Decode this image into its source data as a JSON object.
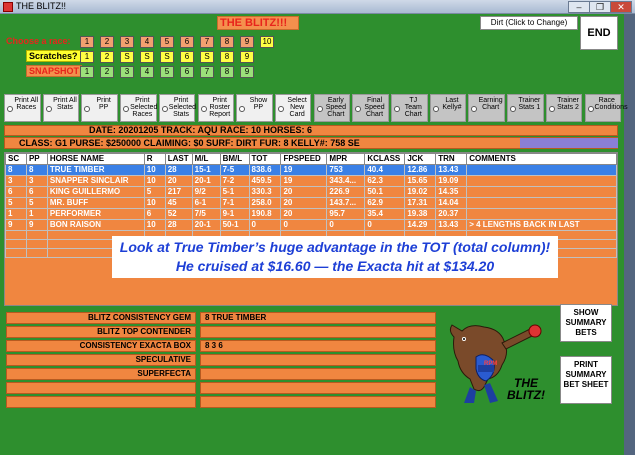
{
  "window": {
    "title": "THE BLITZ!!",
    "buttons": [
      "–",
      "❐",
      "✕"
    ]
  },
  "header": {
    "app_title": "THE BLITZ!!!",
    "surface_button": "Dirt (Click to Change)",
    "end_button": "END"
  },
  "race_select": {
    "choose_label": "Choose a race:",
    "scratches_label": "Scratches?",
    "snapshot_label": "SNAPSHOT",
    "race_numbers": [
      "1",
      "2",
      "3",
      "4",
      "5",
      "6",
      "7",
      "8",
      "9",
      "10"
    ],
    "scratch_marks": [
      "1",
      "2",
      "S",
      "S",
      "S",
      "6",
      "S",
      "8",
      "9"
    ],
    "snapshot_numbers": [
      "1",
      "2",
      "3",
      "4",
      "5",
      "6",
      "7",
      "8",
      "9"
    ]
  },
  "options": [
    {
      "label": "Print All Races"
    },
    {
      "label": "Print All Stats"
    },
    {
      "label": "Print PP"
    },
    {
      "label": "Print Selected Races"
    },
    {
      "label": "Print Selected Stats"
    },
    {
      "label": "Print Roster Report"
    },
    {
      "label": "Show PP"
    },
    {
      "label": "Select New Card"
    },
    {
      "label": "Early Speed Chart"
    },
    {
      "label": "Final Speed Chart"
    },
    {
      "label": "TJ Team Chart"
    },
    {
      "label": "Last Kelly#"
    },
    {
      "label": "Earning Chart"
    },
    {
      "label": "Trainer Stats 1"
    },
    {
      "label": "Trainer Stats 2"
    },
    {
      "label": "Race Conditions"
    }
  ],
  "race_info": {
    "line1": "DATE: 20201205     TRACK: AQU     RACE: 10     HORSES: 6",
    "line2": "CLASS: G1   PURSE: $250000   CLAIMING: $0    SURF: DIRT      FUR: 8   KELLY#: 758      SE"
  },
  "table": {
    "headers": [
      "SC",
      "PP",
      "HORSE NAME",
      "R",
      "LAST",
      "M/L",
      "BM/L",
      "TOT",
      "FPSPEED",
      "MPR",
      "KCLASS",
      "JCK",
      "TRN",
      "COMMENTS"
    ],
    "rows": [
      [
        "8",
        "8",
        "TRUE TIMBER",
        "10",
        "28",
        "15-1",
        "7-5",
        "838.6",
        "19",
        "753",
        "40.4",
        "12.86",
        "13.43",
        ""
      ],
      [
        "3",
        "3",
        "SNAPPER SINCLAIR",
        "10",
        "20",
        "20-1",
        "7-2",
        "459.5",
        "19",
        "343.4...",
        "62.3",
        "15.65",
        "19.09",
        ""
      ],
      [
        "6",
        "6",
        "KING GUILLERMO",
        "5",
        "217",
        "9/2",
        "5-1",
        "330.3",
        "20",
        "226.9",
        "50.1",
        "19.02",
        "14.35",
        ""
      ],
      [
        "5",
        "5",
        "MR. BUFF",
        "10",
        "45",
        "6-1",
        "7-1",
        "258.0",
        "20",
        "143.7...",
        "62.9",
        "17.31",
        "14.04",
        ""
      ],
      [
        "1",
        "1",
        "PERFORMER",
        "6",
        "52",
        "7/5",
        "9-1",
        "190.8",
        "20",
        "95.7",
        "35.4",
        "19.38",
        "20.37",
        ""
      ],
      [
        "9",
        "9",
        "BON RAISON",
        "10",
        "28",
        "20-1",
        "50-1",
        "0",
        "0",
        "0",
        "0",
        "14.29",
        "13.43",
        "> 4 LENGTHS BACK IN LAST"
      ]
    ],
    "selected_row": 0
  },
  "annotation": {
    "text": "Look at True Timber’s huge advantage in the TOT (total column)!  He cruised at $16.60 — the Exacta hit at  $134.20"
  },
  "picks": {
    "labels": [
      "BLITZ CONSISTENCY GEM",
      "BLITZ TOP CONTENDER",
      "CONSISTENCY EXACTA BOX",
      "SPECULATIVE",
      "SUPERFECTA"
    ],
    "values": [
      "8    TRUE TIMBER",
      "",
      "8    3    6",
      "",
      ""
    ]
  },
  "logo": {
    "badge": "RPM",
    "caption": "THE BLITZ!"
  },
  "actions": {
    "show_summary": "SHOW SUMMARY BETS",
    "print_summary": "PRINT SUMMARY BET SHEET"
  },
  "colors": {
    "accent_orange": "#f08640",
    "field_green": "#2e8f2e",
    "selected_blue": "#3a80e6"
  }
}
